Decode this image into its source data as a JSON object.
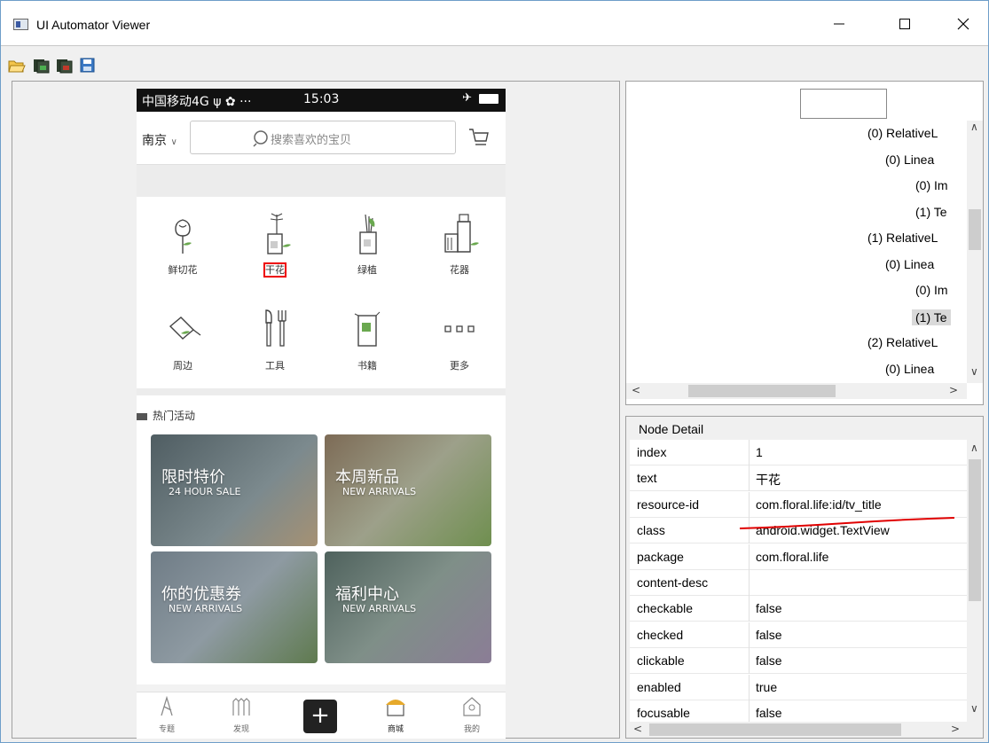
{
  "window": {
    "title": "UI Automator Viewer",
    "minimize_glyph": "—",
    "close_glyph": "✕"
  },
  "toolbar": {
    "icons": [
      "open-folder-icon",
      "device-screenshot-icon",
      "device-screenshot-compressed-icon",
      "save-icon"
    ]
  },
  "phone": {
    "status": {
      "left": "中国移动4G ψ ✿ ···",
      "time": "15:03"
    },
    "city": "南京",
    "search_placeholder": "搜索喜欢的宝贝",
    "categories": [
      {
        "label": "鲜切花",
        "icon": "rose-icon"
      },
      {
        "label": "干花",
        "icon": "dried-flower-icon"
      },
      {
        "label": "绿植",
        "icon": "green-plant-icon"
      },
      {
        "label": "花器",
        "icon": "vase-icon"
      },
      {
        "label": "周边",
        "icon": "watering-can-icon"
      },
      {
        "label": "工具",
        "icon": "tools-icon"
      },
      {
        "label": "书籍",
        "icon": "book-icon"
      },
      {
        "label": "更多",
        "icon": "more-dots-icon"
      }
    ],
    "hot_title": "热门活动",
    "banners": [
      {
        "big": "限时特价",
        "small": "24 HOUR SALE",
        "color": "#5b6b6f"
      },
      {
        "big": "本周新品",
        "small": "NEW ARRIVALS",
        "color": "#8a7a66"
      },
      {
        "big": "你的优惠券",
        "small": "NEW ARRIVALS",
        "color": "#7b8790"
      },
      {
        "big": "福利中心",
        "small": "NEW ARRIVALS",
        "color": "#5d6e68"
      }
    ],
    "nav": [
      {
        "label": "专题"
      },
      {
        "label": "发现"
      },
      {
        "label": "商城"
      },
      {
        "label": "我的"
      }
    ],
    "plus": "+"
  },
  "tree": {
    "lines": [
      {
        "text": "(0) RelativeL",
        "indent": 0
      },
      {
        "text": "(0) Linea",
        "indent": 1
      },
      {
        "text": "(0) Im",
        "indent": 2
      },
      {
        "text": "(1) Te",
        "indent": 2
      },
      {
        "text": "(1) RelativeL",
        "indent": 0
      },
      {
        "text": "(0) Linea",
        "indent": 1
      },
      {
        "text": "(0) Im",
        "indent": 2
      },
      {
        "text": "(1) Te",
        "indent": 2,
        "selected": true
      },
      {
        "text": "(2) RelativeL",
        "indent": 0
      },
      {
        "text": "(0) Linea",
        "indent": 1
      }
    ]
  },
  "node_detail": {
    "title": "Node Detail",
    "rows": [
      {
        "key": "index",
        "value": "1"
      },
      {
        "key": "text",
        "value": "干花"
      },
      {
        "key": "resource-id",
        "value": "com.floral.life:id/tv_title"
      },
      {
        "key": "class",
        "value": "android.widget.TextView"
      },
      {
        "key": "package",
        "value": "com.floral.life"
      },
      {
        "key": "content-desc",
        "value": ""
      },
      {
        "key": "checkable",
        "value": "false"
      },
      {
        "key": "checked",
        "value": "false"
      },
      {
        "key": "clickable",
        "value": "false"
      },
      {
        "key": "enabled",
        "value": "true"
      },
      {
        "key": "focusable",
        "value": "false"
      }
    ]
  },
  "colors": {
    "annotation": "#e00000",
    "selected_row": "#d9d9d9"
  }
}
